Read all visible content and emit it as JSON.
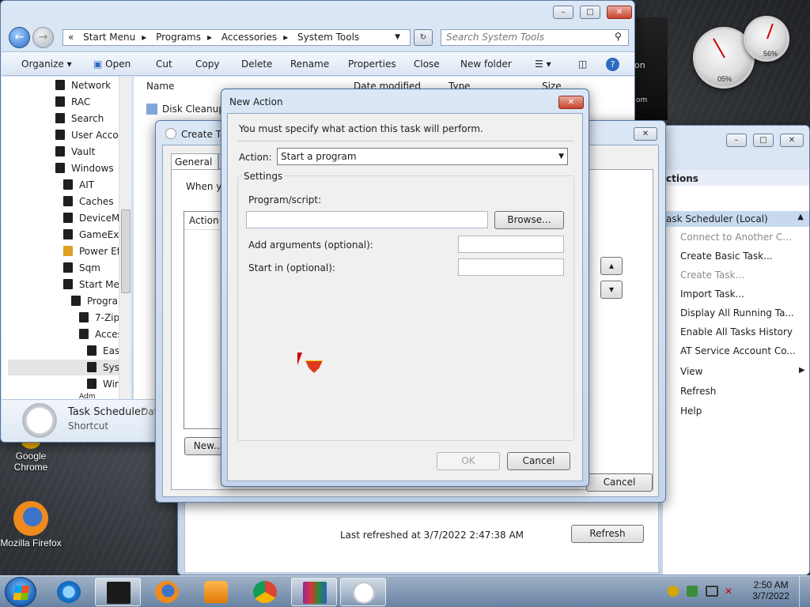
{
  "explorer": {
    "breadcrumb": [
      "«",
      "Start Menu",
      "Programs",
      "Accessories",
      "System Tools"
    ],
    "search_placeholder": "Search System Tools",
    "toolbar": [
      "Organize",
      "Open",
      "Cut",
      "Copy",
      "Delete",
      "Rename",
      "Properties",
      "Close",
      "New folder"
    ],
    "nav_items": [
      "Network",
      "RAC",
      "Search",
      "User Accou",
      "Vault",
      "Windows",
      "AIT",
      "Caches",
      "DeviceMe",
      "GameExp",
      "Power Eff",
      "Sqm",
      "Start Mer",
      "Prograr",
      "7-Zip",
      "Acces",
      "Eas",
      "Syst",
      "Wir",
      "Adm"
    ],
    "columns": [
      "Name",
      "Date modified",
      "Type",
      "Size"
    ],
    "files": [
      "Disk Cleanup"
    ],
    "details": {
      "name": "Task Scheduler",
      "type": "Shortcut",
      "extra": "Dat"
    }
  },
  "create_task": {
    "title": "Create Ta",
    "tabs": [
      "General",
      "T"
    ],
    "intro": "When yo",
    "action_header": "Action",
    "new_button": "New...",
    "cancel_button": "Cancel"
  },
  "task_scheduler": {
    "actions_header": "ctions",
    "section": "ask Scheduler (Local)",
    "actions": [
      {
        "label": "Connect to Another C...",
        "enabled": false
      },
      {
        "label": "Create Basic Task...",
        "enabled": true
      },
      {
        "label": "Create Task...",
        "enabled": false
      },
      {
        "label": "Import Task...",
        "enabled": true
      },
      {
        "label": "Display All Running Ta...",
        "enabled": true
      },
      {
        "label": "Enable All Tasks History",
        "enabled": true
      },
      {
        "label": "AT Service Account Co...",
        "enabled": true
      },
      {
        "label": "View",
        "enabled": true
      },
      {
        "label": "Refresh",
        "enabled": true
      },
      {
        "label": "Help",
        "enabled": true
      }
    ],
    "last_refreshed": "Last refreshed at 3/7/2022 2:47:38 AM",
    "refresh_button": "Refresh"
  },
  "new_action": {
    "title": "New Action",
    "instruction": "You must specify what action this task will perform.",
    "action_label": "Action:",
    "action_value": "Start a program",
    "settings_label": "Settings",
    "program_label": "Program/script:",
    "program_value": "",
    "browse_button": "Browse...",
    "args_label": "Add arguments (optional):",
    "args_value": "",
    "startin_label": "Start in (optional):",
    "startin_value": "",
    "ok_button": "OK",
    "cancel_button": "Cancel"
  },
  "desktop": {
    "icons": [
      "Google Chrome",
      "Mozilla Firefox"
    ],
    "gadgets": {
      "cpu": "05%",
      "mem": "56%"
    },
    "media_text": [
      "on",
      "om"
    ]
  },
  "taskbar": {
    "time": "2:50 AM",
    "date": "3/7/2022"
  }
}
